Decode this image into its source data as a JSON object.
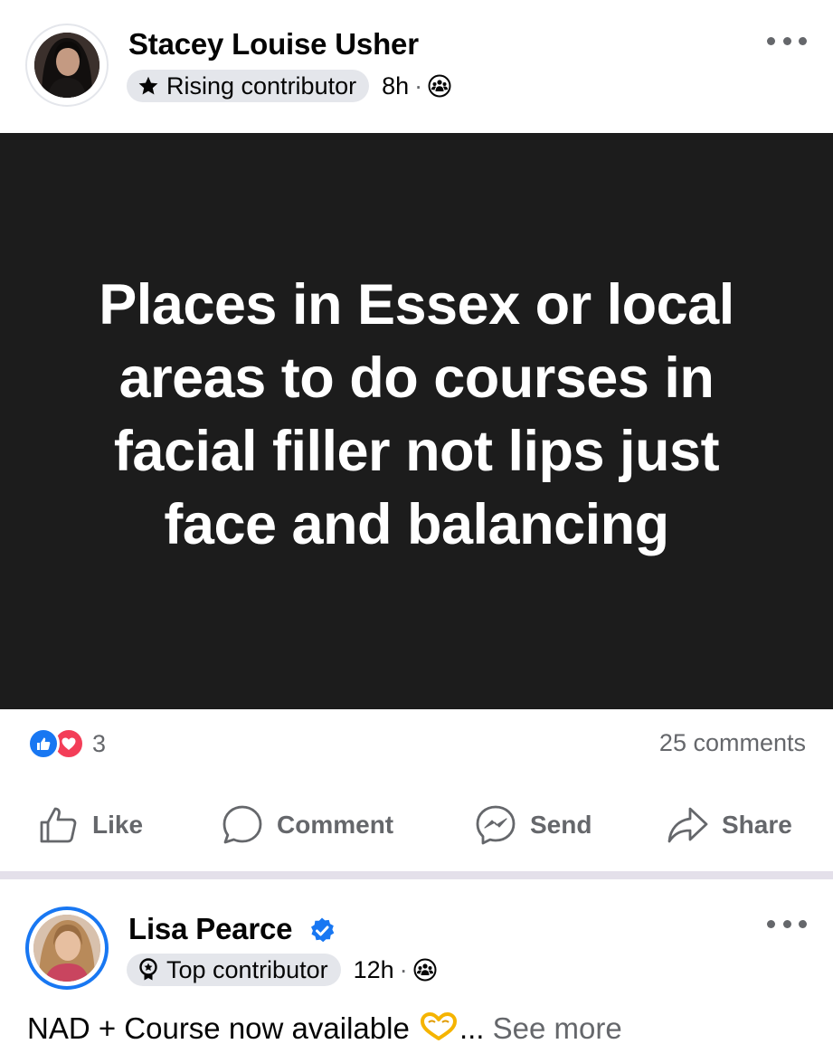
{
  "post1": {
    "author": "Stacey Louise Usher",
    "badge": "Rising contributor",
    "time": "8h",
    "separator": "·",
    "text": "Places in Essex or local areas to do courses in facial filler not lips just face and balancing",
    "text_card_color": "#1c1c1c",
    "reaction_count": "3",
    "comments_count": "25 comments",
    "actions": {
      "like": "Like",
      "comment": "Comment",
      "send": "Send",
      "share": "Share"
    }
  },
  "post2": {
    "author": "Lisa Pearce",
    "badge": "Top contributor",
    "time": "12h",
    "separator": "·",
    "text": "NAD + Course now available ",
    "ellipsis": "...",
    "see_more": "See more"
  },
  "icons": {
    "badge_rising": "star-icon",
    "badge_top": "award-icon",
    "audience": "group-icon",
    "reactions": [
      "like-reaction-icon",
      "love-reaction-icon"
    ],
    "verified": "verified-badge-icon",
    "emoji": "heart-hands-emoji"
  },
  "colors": {
    "facebook_blue": "#1877f2",
    "love_red": "#f33e58",
    "secondary_text": "#65676b",
    "badge_bg": "#e4e6eb"
  }
}
